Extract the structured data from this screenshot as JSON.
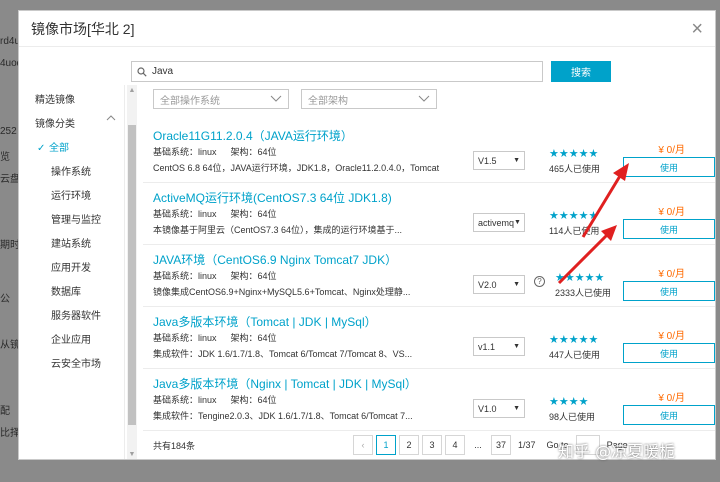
{
  "modal": {
    "title": "镜像市场[华北 2]",
    "close": "×"
  },
  "search": {
    "value": "Java",
    "button": "搜索"
  },
  "sidebar": {
    "featured": "精选镜像",
    "category": "镜像分类",
    "items": [
      "全部",
      "操作系统",
      "运行环境",
      "管理与监控",
      "建站系统",
      "应用开发",
      "数据库",
      "服务器软件",
      "企业应用",
      "云安全市场"
    ]
  },
  "filters": {
    "os": "全部操作系统",
    "arch": "全部架构"
  },
  "rows": [
    {
      "title": "Oracle11G11.2.0.4（JAVA运行环境）",
      "base": "基础系统：linux",
      "arch": "架构：64位",
      "desc": "CentOS 6.8 64位，JAVA运行环境，JDK1.8，Oracle11.2.0.4.0，Tomcat",
      "version": "V1.5",
      "usage": "465人已使用",
      "stars": "★★★★★",
      "price": "¥ 0/月",
      "use": "使用"
    },
    {
      "title": "ActiveMQ运行环境(CentOS7.3 64位 JDK1.8)",
      "base": "基础系统：linux",
      "arch": "架构：64位",
      "desc": "本镜像基于阿里云（CentOS7.3 64位），集成的运行环境基于...",
      "version": "activemq",
      "usage": "114人已使用",
      "stars": "★★★★★",
      "price": "¥ 0/月",
      "use": "使用"
    },
    {
      "title": "JAVA环境（CentOS6.9 Nginx Tomcat7 JDK）",
      "base": "基础系统：linux",
      "arch": "架构：64位",
      "desc": "镜像集成CentOS6.9+Nginx+MySQL5.6+Tomcat、Nginx处理静...",
      "version": "V2.0",
      "usage": "2333人已使用",
      "stars": "★★★★★",
      "price": "¥ 0/月",
      "use": "使用"
    },
    {
      "title": "Java多版本环境（Tomcat | JDK | MySql）",
      "base": "基础系统：linux",
      "arch": "架构：64位",
      "desc": "集成软件：JDK 1.6/1.7/1.8、Tomcat 6/Tomcat 7/Tomcat 8、VS...",
      "version": "v1.1",
      "usage": "447人已使用",
      "stars": "★★★★★",
      "price": "¥ 0/月",
      "use": "使用"
    },
    {
      "title": "Java多版本环境（Nginx | Tomcat | JDK | MySql）",
      "base": "基础系统：linux",
      "arch": "架构：64位",
      "desc": "集成软件：Tengine2.0.3、JDK 1.6/1.7/1.8、Tomcat 6/Tomcat 7...",
      "version": "V1.0",
      "usage": "98人已使用",
      "stars": "★★★★",
      "price": "¥ 0/月",
      "use": "使用"
    }
  ],
  "footer": {
    "total": "共有184条",
    "pages": [
      "1",
      "2",
      "3",
      "4",
      "...",
      "37"
    ],
    "page_info": "1/37",
    "goto": "Go to",
    "page_label": "Page",
    "prev": "‹"
  },
  "watermark": "知乎 @凉夏暖栀",
  "colors": {
    "accent": "#00a2ca",
    "price": "#ff6a00",
    "arrow": "#e02020"
  },
  "background": {
    "fragments": [
      "rd4u",
      "4uod",
      "252",
      "览",
      "云盘",
      "期时",
      "公",
      "从镜",
      "配",
      "比择 S"
    ]
  }
}
